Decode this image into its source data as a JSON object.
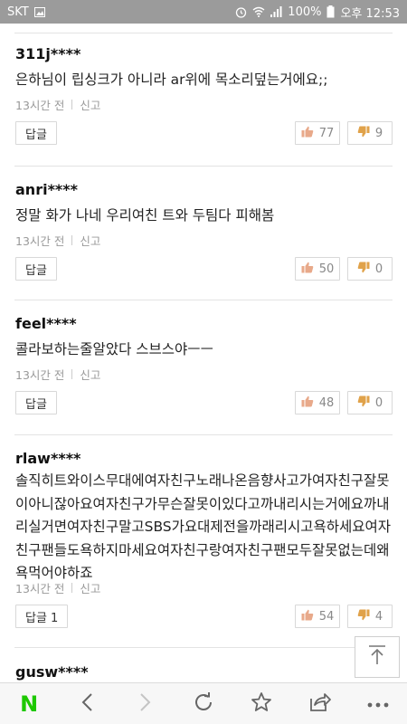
{
  "status_bar": {
    "carrier": "SKT",
    "battery": "100%",
    "time": "오후 12:53"
  },
  "comments": [
    {
      "user": "311j****",
      "text": "은하님이 립싱크가 아니라 ar위에 목소리덮는거에요;;",
      "time": "13시간 전",
      "report": "신고",
      "reply_label": "답글",
      "likes": "77",
      "dislikes": "9"
    },
    {
      "user": "anri****",
      "text": "정말 화가 나네 우리여친 트와 두팀다 피해봄",
      "time": "13시간 전",
      "report": "신고",
      "reply_label": "답글",
      "likes": "50",
      "dislikes": "0"
    },
    {
      "user": "feel****",
      "text": "콜라보하는줄알았다 스브스야ㅡㅡ",
      "time": "13시간 전",
      "report": "신고",
      "reply_label": "답글",
      "likes": "48",
      "dislikes": "0"
    },
    {
      "user": "rlaw****",
      "text": "솔직히트와이스무대에여자친구노래나온음향사고가여자친구잘못이아니잖아요여자친구가무슨잘못이있다고까내리시는거에요까내리실거면여자친구말고SBS가요대제전을까래리시고욕하세요여자친구팬들도욕하지마세요여자친구랑여자친구팬모두잘못없는데왜욕먹어야하죠",
      "time": "13시간 전",
      "report": "신고",
      "reply_label": "답글 1",
      "likes": "54",
      "dislikes": "4"
    },
    {
      "user": "gusw****"
    }
  ],
  "icons": {
    "scroll_top": "arrow-up-to-top-icon",
    "naver_logo": "N",
    "back": "chevron-left-icon",
    "forward": "chevron-right-icon",
    "refresh": "refresh-icon",
    "bookmark": "star-icon",
    "share": "share-icon",
    "more": "more-dots-icon"
  },
  "colors": {
    "status_bar": "#9b9b9b",
    "naver_green": "#1ec800",
    "like_thumb": "#e8a98a",
    "dislike_thumb": "#e0a24a"
  }
}
